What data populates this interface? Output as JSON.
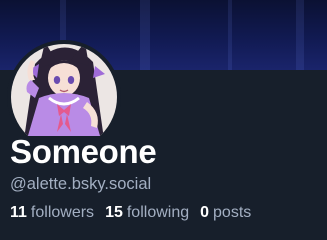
{
  "profile": {
    "display_name": "Someone",
    "handle": "@alette.bsky.social",
    "stats": {
      "followers_count": "11",
      "followers_label": "followers",
      "following_count": "15",
      "following_label": "following",
      "posts_count": "0",
      "posts_label": "posts"
    }
  },
  "colors": {
    "background": "#171f2b",
    "name": "#ffffff",
    "muted_text": "#a3afc2",
    "banner": "#111a52"
  }
}
